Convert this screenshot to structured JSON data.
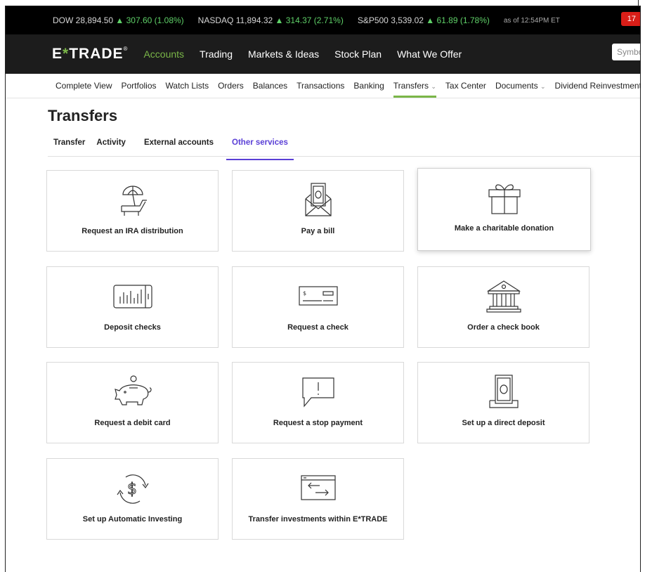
{
  "ticker": {
    "dow_label": "DOW",
    "dow_value": "28,894.50",
    "dow_change": "▲ 307.60 (1.08%)",
    "nasdaq_label": "NASDAQ",
    "nasdaq_value": "11,894.32",
    "nasdaq_change": "▲ 314.37 (2.71%)",
    "sp_label": "S&P500",
    "sp_value": "3,539.02",
    "sp_change": "▲ 61.89 (1.78%)",
    "as_of": "as of 12:54PM ET",
    "badge": "17",
    "up_color": "#5fd068"
  },
  "header": {
    "logo_left": "E",
    "logo_star": "*",
    "logo_right": "TRADE",
    "logo_mark": "®",
    "nav": [
      "Accounts",
      "Trading",
      "Markets & Ideas",
      "Stock Plan",
      "What We Offer"
    ],
    "active_nav": "Accounts",
    "search_placeholder": "Symbol",
    "accent": "#7ab648"
  },
  "subnav": {
    "items": [
      "Complete View",
      "Portfolios",
      "Watch Lists",
      "Orders",
      "Balances",
      "Transactions",
      "Banking",
      "Transfers",
      "Tax Center",
      "Documents",
      "Dividend Reinvestment"
    ],
    "active": "Transfers"
  },
  "page": {
    "title": "Transfers",
    "tabs": [
      "Transfer",
      "Activity",
      "External accounts",
      "Other services"
    ],
    "active_tab": "Other services",
    "tab_accent": "#5a3fd6"
  },
  "services": [
    {
      "label": "Request an IRA distribution",
      "icon": "beach-chair-icon"
    },
    {
      "label": "Pay a bill",
      "icon": "envelope-cash-icon"
    },
    {
      "label": "Make a charitable donation",
      "icon": "gift-icon"
    },
    {
      "label": "Deposit checks",
      "icon": "mobile-check-icon"
    },
    {
      "label": "Request a check",
      "icon": "check-icon"
    },
    {
      "label": "Order a check book",
      "icon": "bank-icon"
    },
    {
      "label": "Request a debit card",
      "icon": "piggy-bank-icon"
    },
    {
      "label": "Request a stop payment",
      "icon": "alert-bubble-icon"
    },
    {
      "label": "Set up a direct deposit",
      "icon": "deposit-slot-icon"
    },
    {
      "label": "Set up Automatic Investing",
      "icon": "dollar-cycle-icon"
    },
    {
      "label": "Transfer investments within E*TRADE",
      "icon": "transfer-window-icon"
    }
  ]
}
